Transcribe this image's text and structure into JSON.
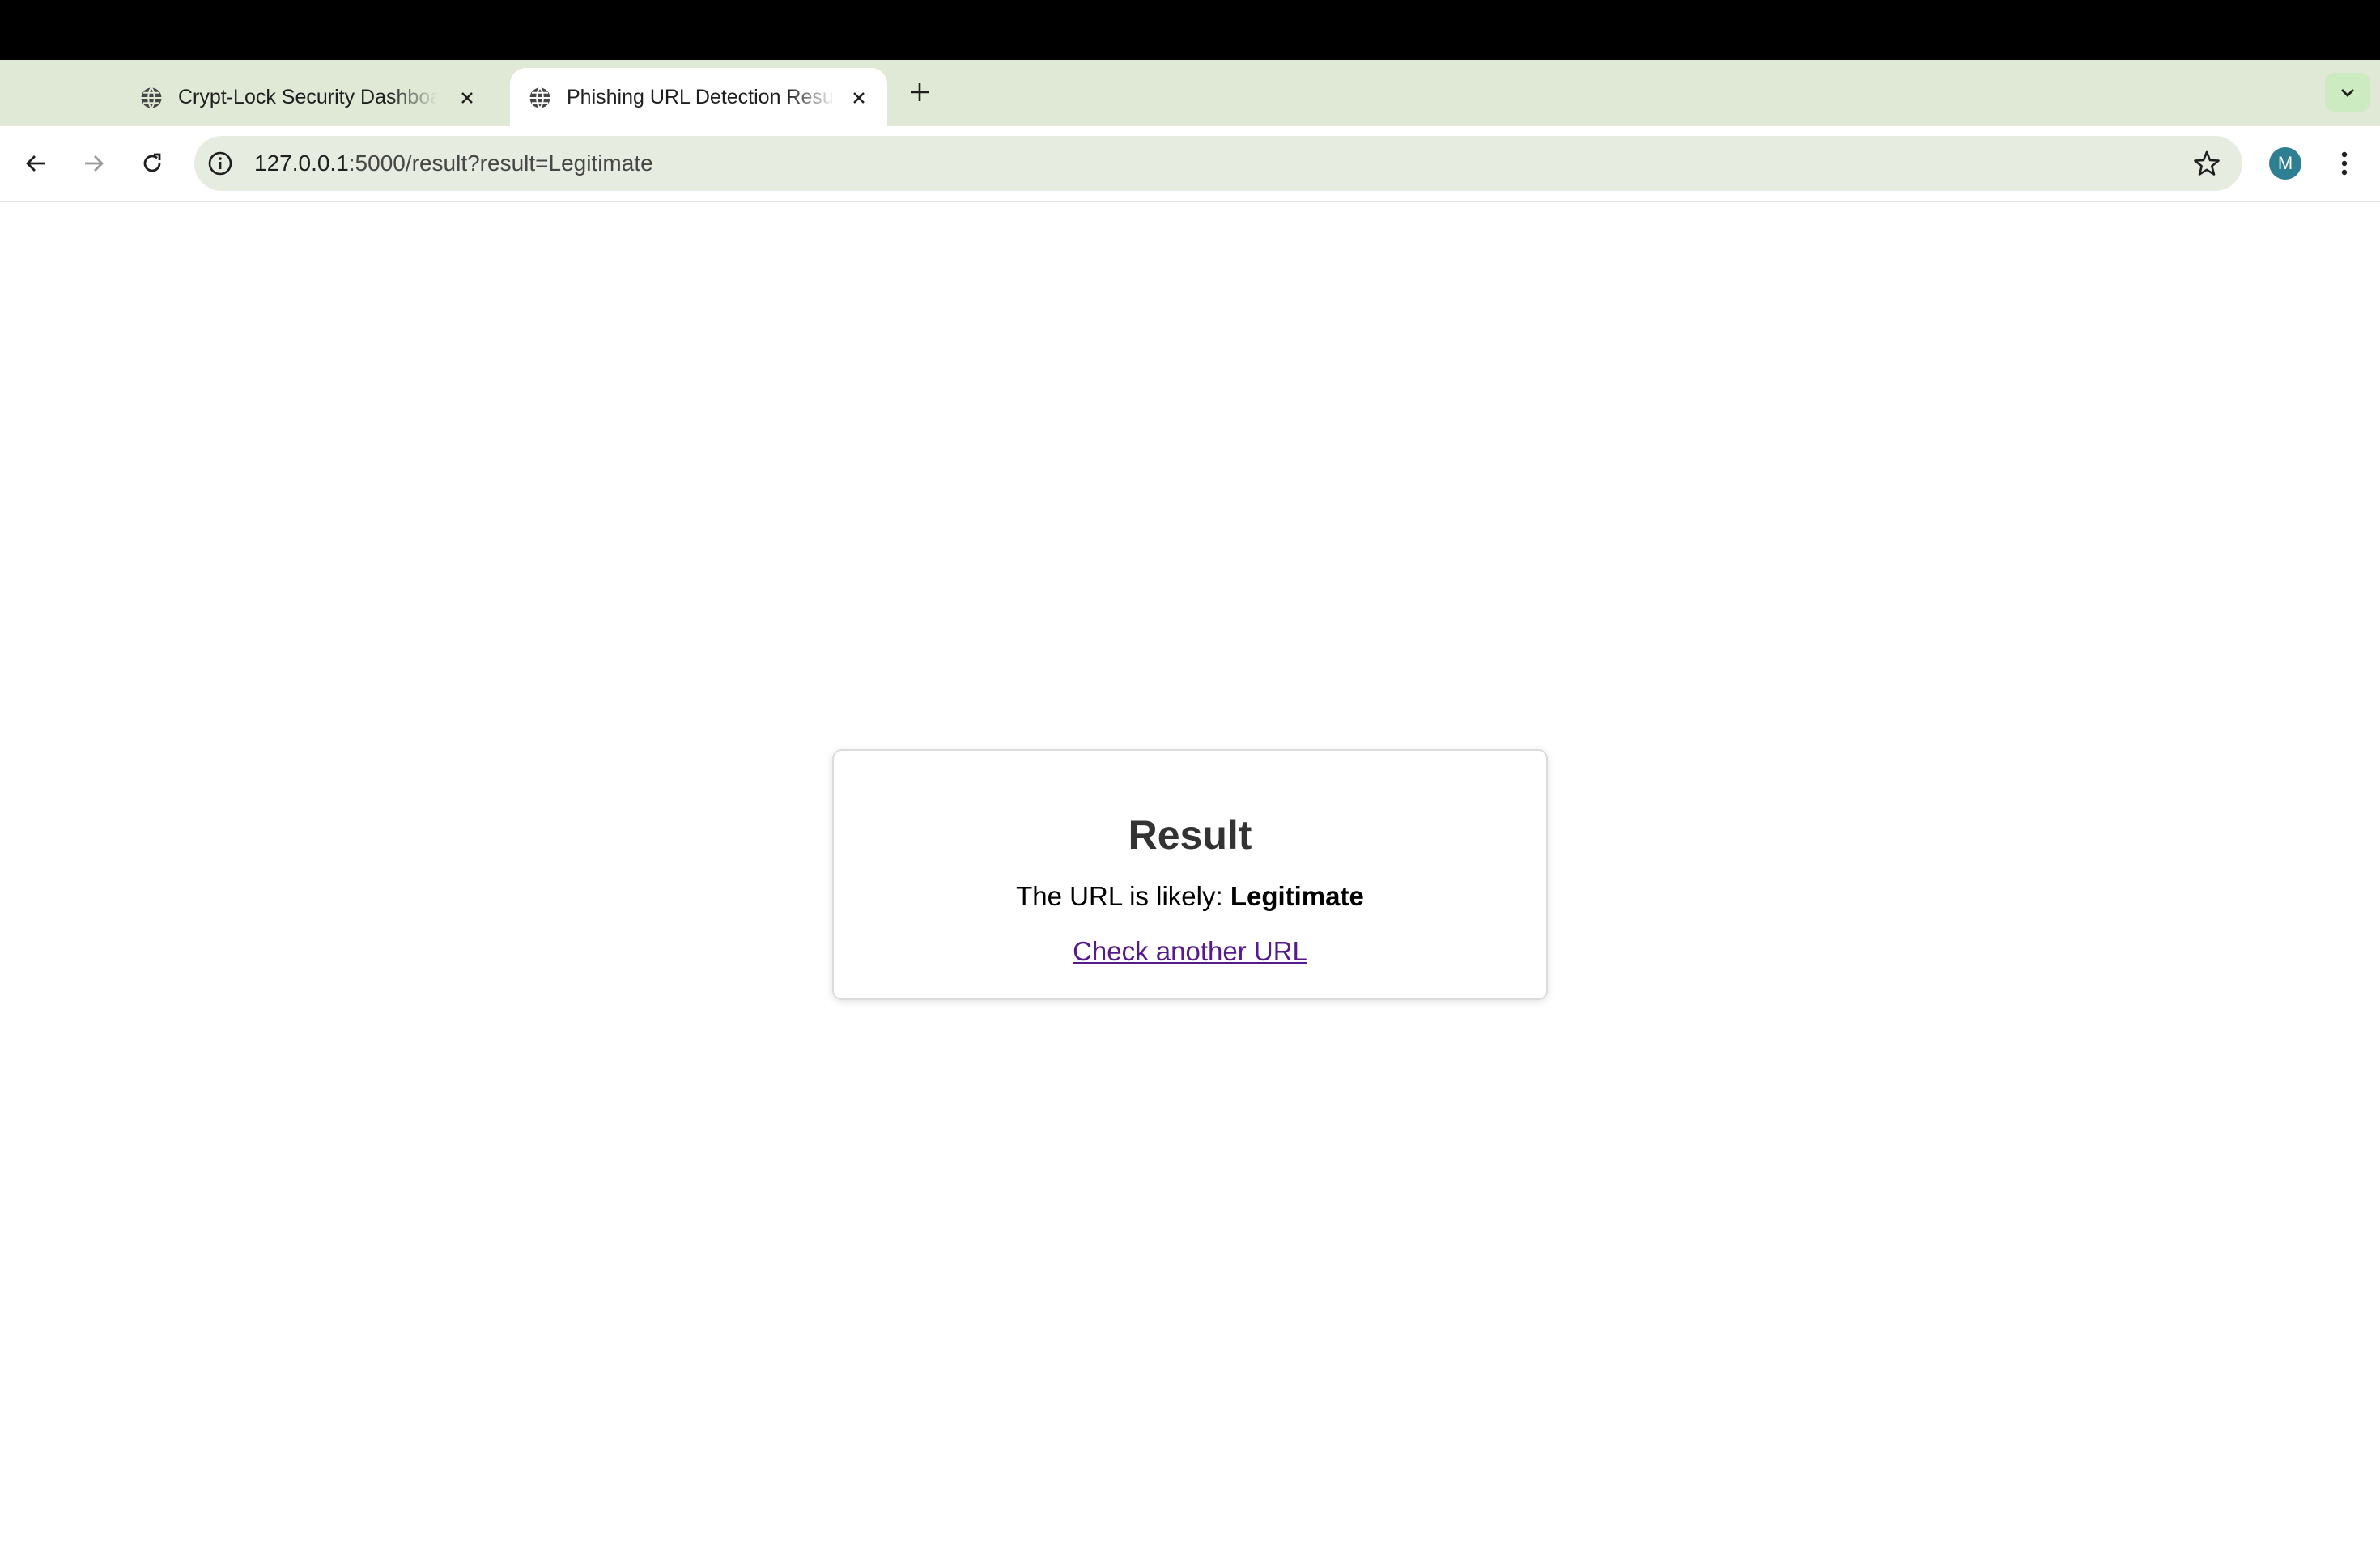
{
  "browser": {
    "tabs": [
      {
        "title": "Crypt-Lock Security Dashboard",
        "active": false
      },
      {
        "title": "Phishing URL Detection Result",
        "active": true
      }
    ],
    "address_bar": {
      "host": "127.0.0.1",
      "rest": ":5000/result?result=Legitimate"
    },
    "profile_initial": "M",
    "icons": {
      "favicon": "globe-icon",
      "close": "close-icon",
      "new_tab": "plus-icon",
      "tab_search": "chevron-down-icon",
      "back": "back-arrow-icon",
      "forward": "forward-arrow-icon",
      "reload": "reload-icon",
      "site_info": "info-icon",
      "bookmark": "star-icon",
      "menu": "kebab-menu-icon"
    }
  },
  "page": {
    "heading": "Result",
    "message_prefix": "The URL is likely: ",
    "result_value": "Legitimate",
    "link_label": "Check another URL"
  }
}
